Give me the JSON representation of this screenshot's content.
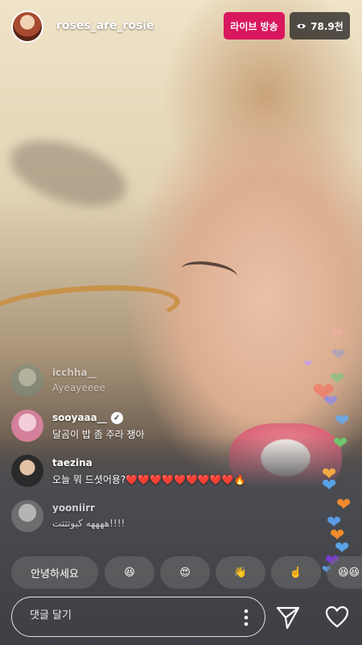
{
  "header": {
    "username": "roses_are_rosie",
    "live_label": "라이브 방송",
    "viewers": "78.9천"
  },
  "comments": [
    {
      "user": "icchha__",
      "text": "Ayeayeeee",
      "verified": false
    },
    {
      "user": "sooyaaa__",
      "text": "달곰이 밥 좀 주라 쟁아",
      "verified": true
    },
    {
      "user": "taezina",
      "text": "오늘 뭐 드셧어용?❤️❤️❤️❤️❤️❤️❤️❤️❤️🔥",
      "verified": false
    },
    {
      "user": "yooniirr",
      "text": "ههههه كيوتتتت!!!!",
      "verified": false
    }
  ],
  "quick_replies": [
    "안녕하세요",
    "😆",
    "😍",
    "👋",
    "☝️",
    "😆😆"
  ],
  "comment_input": {
    "placeholder": "댓글 달기"
  },
  "icons": {
    "viewers": "eye-icon",
    "more": "more-vertical-icon",
    "send": "paper-plane-icon",
    "like": "heart-outline-icon"
  },
  "colors": {
    "live_badge": "#d8175f"
  }
}
